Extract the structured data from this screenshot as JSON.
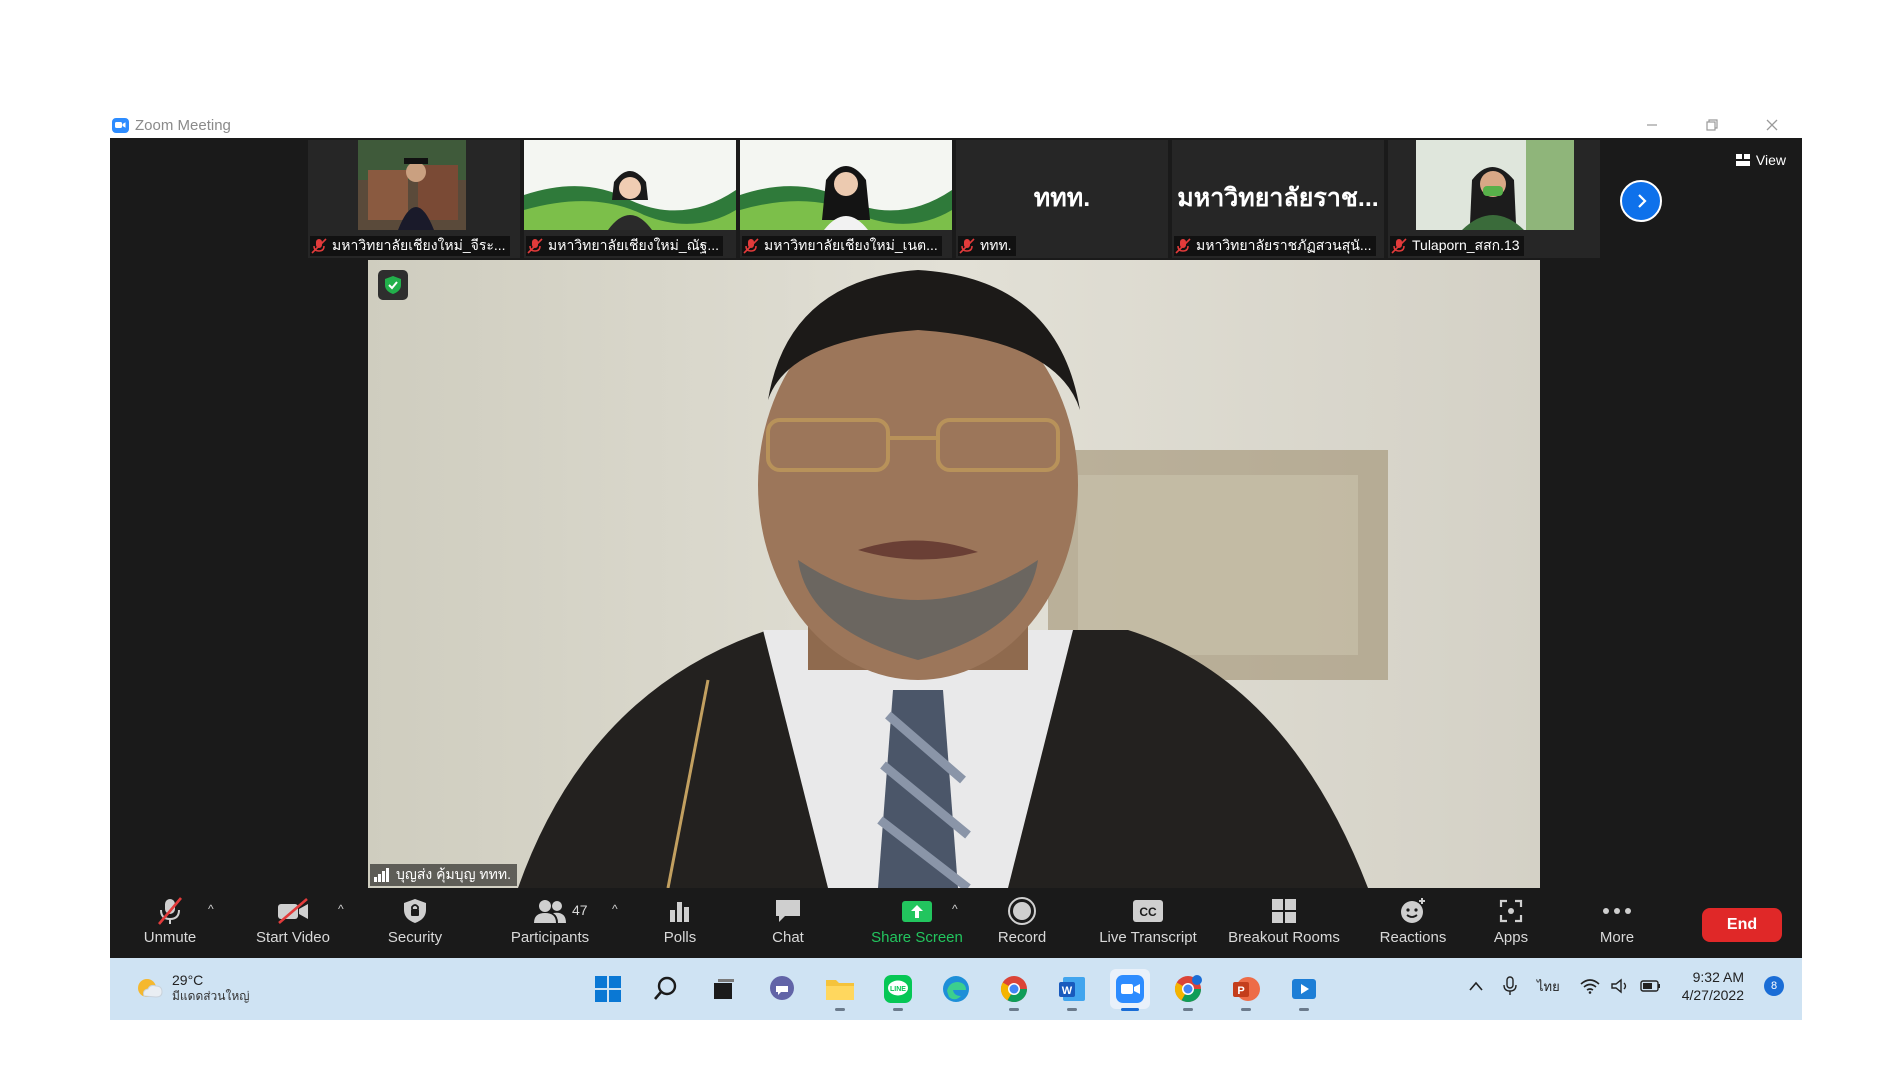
{
  "window": {
    "title": "Zoom Meeting"
  },
  "thumbnails": [
    {
      "label": "มหาวิทยาลัยเชียงใหม่_จีระ...",
      "type": "photo"
    },
    {
      "label": "มหาวิทยาลัยเชียงใหม่_ณัฐ...",
      "type": "photo"
    },
    {
      "label": "มหาวิทยาลัยเชียงใหม่_เนต...",
      "type": "photo"
    },
    {
      "label": "ททท.",
      "big_name": "ททท.",
      "type": "name"
    },
    {
      "label": "มหาวิทยาลัยราชภัฏสวนสุนั...",
      "big_name": "มหาวิทยาลัยราช...",
      "type": "name"
    },
    {
      "label": "Tulaporn_สสก.13",
      "type": "photo"
    }
  ],
  "view_button": "View",
  "main_video": {
    "speaker_label": "บุญส่ง คุ้มบุญ ททท."
  },
  "toolbar": {
    "unmute": "Unmute",
    "start_video": "Start Video",
    "security": "Security",
    "participants": "Participants",
    "participants_count": "47",
    "polls": "Polls",
    "chat": "Chat",
    "share_screen": "Share Screen",
    "record": "Record",
    "live_transcript": "Live Transcript",
    "breakout_rooms": "Breakout Rooms",
    "reactions": "Reactions",
    "apps": "Apps",
    "more": "More",
    "end": "End"
  },
  "taskbar": {
    "weather_temp": "29°C",
    "weather_desc": "มีแดดส่วนใหญ่",
    "language": "ไทย",
    "time": "9:32 AM",
    "date": "4/27/2022",
    "notification_count": "8",
    "apps": [
      "windows-start-icon",
      "search-icon",
      "task-view-icon",
      "teams-chat-icon",
      "file-explorer-icon",
      "line-icon",
      "edge-icon",
      "chrome-icon",
      "word-icon",
      "zoom-icon",
      "chrome-profile-icon",
      "powerpoint-icon",
      "media-player-icon"
    ]
  },
  "colors": {
    "meeting_bg": "#1a1a1a",
    "share_green": "#22c55e",
    "end_red": "#e02828",
    "accent_blue": "#0e71eb",
    "taskbar_bg": "#cfe3f3"
  }
}
